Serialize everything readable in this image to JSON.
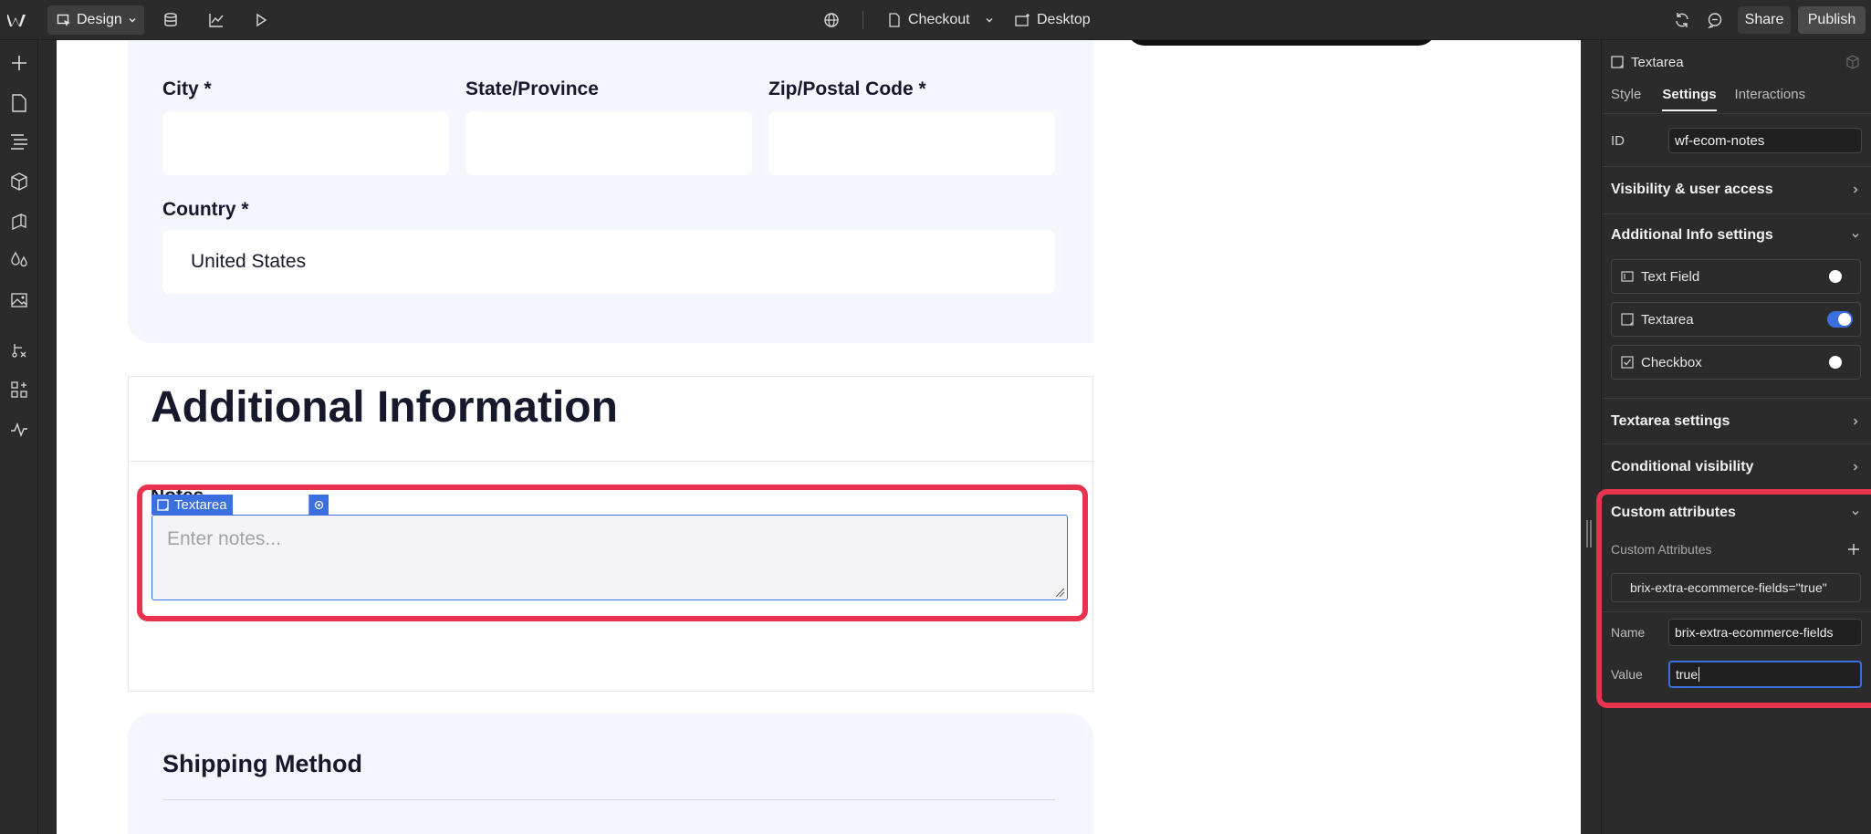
{
  "topbar": {
    "design_label": "Design",
    "page_name": "Checkout",
    "breakpoint": "Desktop",
    "share_label": "Share",
    "publish_label": "Publish"
  },
  "canvas": {
    "address": {
      "city_label": "City *",
      "state_label": "State/Province",
      "zip_label": "Zip/Postal Code *",
      "country_label": "Country *",
      "country_value": "United States"
    },
    "additional": {
      "heading": "Additional Information",
      "notes_label": "Notes",
      "element_tag": "Textarea",
      "notes_placeholder": "Enter notes..."
    },
    "shipping": {
      "heading": "Shipping Method"
    }
  },
  "panel": {
    "element_name": "Textarea",
    "tabs": [
      "Style",
      "Settings",
      "Interactions"
    ],
    "active_tab": "Settings",
    "id_label": "ID",
    "id_value": "wf-ecom-notes",
    "sections": {
      "visibility": "Visibility & user access",
      "additional_info": "Additional Info settings",
      "textarea_settings": "Textarea settings",
      "conditional": "Conditional visibility",
      "custom_attributes": "Custom attributes"
    },
    "toggles": [
      {
        "label": "Text Field",
        "on": false
      },
      {
        "label": "Textarea",
        "on": true
      },
      {
        "label": "Checkbox",
        "on": false
      }
    ],
    "custom_attributes_label": "Custom Attributes",
    "attribute_summary": "brix-extra-ecommerce-fields=\"true\"",
    "name_label": "Name",
    "name_value": "brix-extra-ecommerce-fields",
    "value_label": "Value",
    "value_value": "true"
  },
  "colors": {
    "accent": "#3b6fe0",
    "highlight": "#e8334e",
    "panel_bg": "#f4f6fd"
  }
}
